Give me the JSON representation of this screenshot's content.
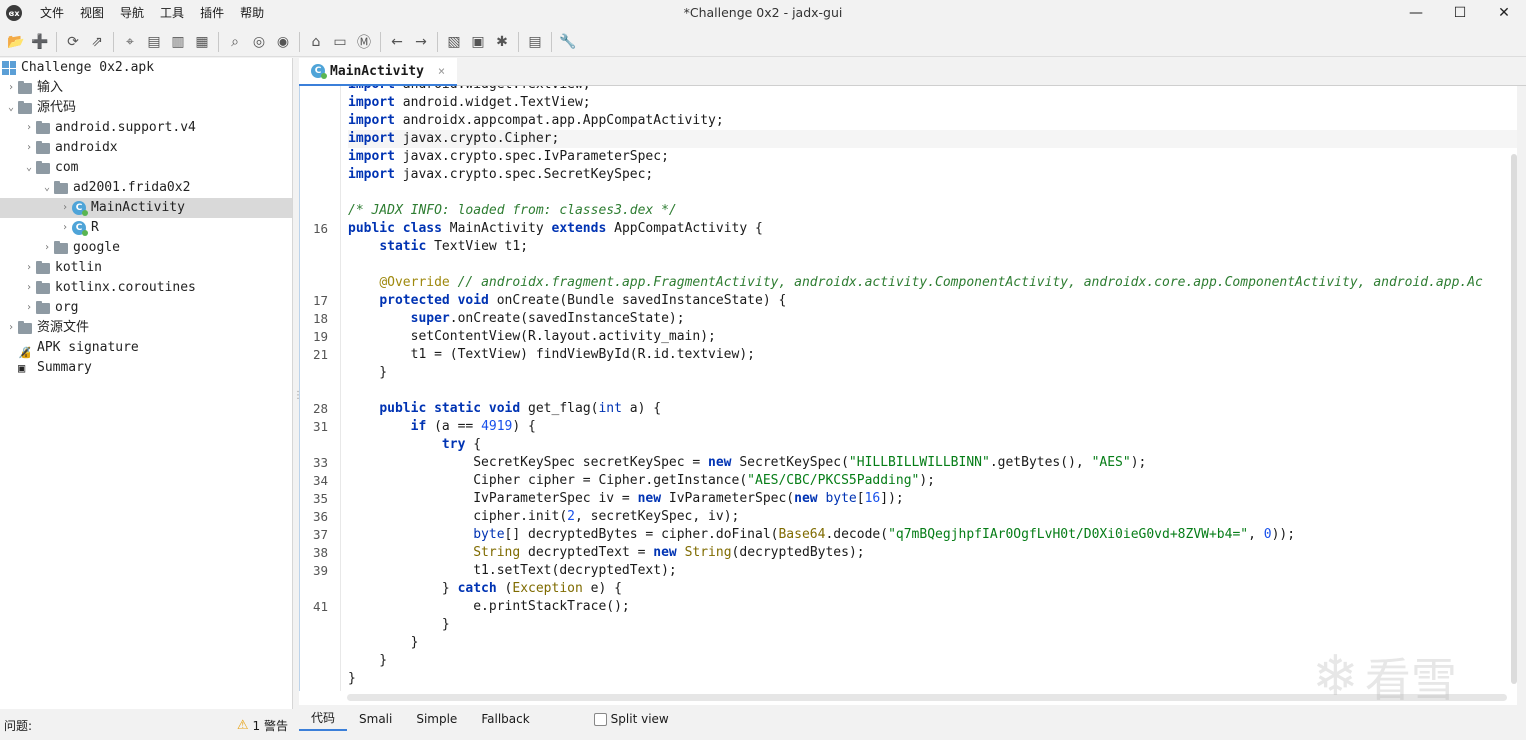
{
  "window": {
    "title": "*Challenge 0x2 - jadx-gui",
    "logo": "ɞx",
    "controls": {
      "minimize": "—",
      "maximize": "☐",
      "close": "✕"
    }
  },
  "menu": [
    "文件",
    "视图",
    "导航",
    "工具",
    "插件",
    "帮助"
  ],
  "toolbar": {
    "icons": [
      "open-file-icon",
      "add-file-icon",
      "sync-icon",
      "export-icon",
      "crosshair-icon",
      "folder-icon",
      "split-view-icon",
      "table-icon",
      "search-icon",
      "search-class-icon",
      "search-usage-icon",
      "home-icon",
      "window-icon",
      "module-icon",
      "back-arrow-icon",
      "forward-arrow-icon",
      "deobfuscation-icon",
      "bookmark-icon",
      "bug-icon",
      "log-icon",
      "settings-wrench-icon"
    ]
  },
  "tree": {
    "items": [
      {
        "label": "Challenge 0x2.apk",
        "icon": "apk",
        "level": 0,
        "arrow": ""
      },
      {
        "label": "输入",
        "icon": "input",
        "level": 0,
        "arrow": "›"
      },
      {
        "label": "源代码",
        "icon": "src",
        "level": 0,
        "arrow": "⌄"
      },
      {
        "label": "android.support.v4",
        "icon": "folder",
        "level": 1,
        "arrow": "›"
      },
      {
        "label": "androidx",
        "icon": "folder",
        "level": 1,
        "arrow": "›"
      },
      {
        "label": "com",
        "icon": "folder",
        "level": 1,
        "arrow": "⌄"
      },
      {
        "label": "ad2001.frida0x2",
        "icon": "folder",
        "level": 2,
        "arrow": "⌄"
      },
      {
        "label": "MainActivity",
        "icon": "class",
        "level": 3,
        "arrow": "›",
        "selected": true
      },
      {
        "label": "R",
        "icon": "class",
        "level": 3,
        "arrow": "›"
      },
      {
        "label": "google",
        "icon": "folder",
        "level": 2,
        "arrow": "›"
      },
      {
        "label": "kotlin",
        "icon": "folder",
        "level": 1,
        "arrow": "›"
      },
      {
        "label": "kotlinx.coroutines",
        "icon": "folder",
        "level": 1,
        "arrow": "›"
      },
      {
        "label": "org",
        "icon": "folder",
        "level": 1,
        "arrow": "›"
      },
      {
        "label": "资源文件",
        "icon": "res",
        "level": 0,
        "arrow": "›"
      },
      {
        "label": "APK signature",
        "icon": "sig",
        "level": 0,
        "arrow": ""
      },
      {
        "label": "Summary",
        "icon": "summary",
        "level": 0,
        "arrow": ""
      }
    ]
  },
  "tab": {
    "label": "MainActivity",
    "close": "×"
  },
  "editor": {
    "lines": [
      {
        "n": "",
        "html": "<span class='kw'>import</span> android.widget.TextView;"
      },
      {
        "n": "",
        "html": "<span class='kw'>import</span> android.widget.TextView;"
      },
      {
        "n": "",
        "html": "<span class='kw'>import</span> androidx.appcompat.app.AppCompatActivity;"
      },
      {
        "n": "",
        "html": "<span class='kw'>import</span> javax.crypto.Cipher;",
        "cur": true
      },
      {
        "n": "",
        "html": "<span class='kw'>import</span> javax.crypto.spec.IvParameterSpec;"
      },
      {
        "n": "",
        "html": "<span class='kw'>import</span> javax.crypto.spec.SecretKeySpec;"
      },
      {
        "n": "",
        "html": ""
      },
      {
        "n": "",
        "html": "<span class='cmt2'>/* JADX INFO: loaded from: classes3.dex */</span>"
      },
      {
        "n": "16",
        "html": "<span class='kw'>public class</span> MainActivity <span class='kw'>extends</span> AppCompatActivity {"
      },
      {
        "n": "",
        "html": "    <span class='kw'>static</span> TextView t1;"
      },
      {
        "n": "",
        "html": ""
      },
      {
        "n": "",
        "html": "    <span class='ann'>@Override</span> <span class='cmt2'>// androidx.fragment.app.FragmentActivity, androidx.activity.ComponentActivity, androidx.core.app.ComponentActivity, android.app.Ac</span>"
      },
      {
        "n": "17",
        "html": "    <span class='kw'>protected void</span> onCreate(Bundle savedInstanceState) {"
      },
      {
        "n": "18",
        "html": "        <span class='kw'>super</span>.onCreate(savedInstanceState);"
      },
      {
        "n": "19",
        "html": "        setContentView(R.layout.activity_main);"
      },
      {
        "n": "21",
        "html": "        t1 = (TextView) findViewById(R.id.textview);"
      },
      {
        "n": "",
        "html": "    }"
      },
      {
        "n": "",
        "html": ""
      },
      {
        "n": "28",
        "html": "    <span class='kw'>public static void</span> get_flag(<span class='kwn'>int</span> a) {"
      },
      {
        "n": "31",
        "html": "        <span class='kw'>if</span> (a == <span class='num'>4919</span>) {"
      },
      {
        "n": "",
        "html": "            <span class='kw'>try</span> {"
      },
      {
        "n": "33",
        "html": "                SecretKeySpec secretKeySpec = <span class='kw'>new</span> SecretKeySpec(<span class='str'>\"HILLBILLWILLBINN\"</span>.getBytes(), <span class='str'>\"AES\"</span>);"
      },
      {
        "n": "34",
        "html": "                Cipher cipher = Cipher.getInstance(<span class='str'>\"AES/CBC/PKCS5Padding\"</span>);"
      },
      {
        "n": "35",
        "html": "                IvParameterSpec iv = <span class='kw'>new</span> IvParameterSpec(<span class='kw'>new</span> <span class='kwn'>byte</span>[<span class='num'>16</span>]);"
      },
      {
        "n": "36",
        "html": "                cipher.init(<span class='num'>2</span>, secretKeySpec, iv);"
      },
      {
        "n": "37",
        "html": "                <span class='kwn'>byte</span>[] decryptedBytes = cipher.doFinal(<span class='typ'>Base64</span>.decode(<span class='str'>\"q7mBQegjhpfIAr0OgfLvH0t/D0Xi0ieG0vd+8ZVW+b4=\"</span>, <span class='num'>0</span>));"
      },
      {
        "n": "38",
        "html": "                <span class='typ'>String</span> decryptedText = <span class='kw'>new</span> <span class='typ'>String</span>(decryptedBytes);"
      },
      {
        "n": "39",
        "html": "                t1.setText(decryptedText);"
      },
      {
        "n": "",
        "html": "            } <span class='kw'>catch</span> (<span class='typ'>Exception</span> e) {"
      },
      {
        "n": "41",
        "html": "                e.printStackTrace();"
      },
      {
        "n": "",
        "html": "            }"
      },
      {
        "n": "",
        "html": "        }"
      },
      {
        "n": "",
        "html": "    }"
      },
      {
        "n": "",
        "html": "}"
      }
    ]
  },
  "bottom_tabs": [
    "代码",
    "Smali",
    "Simple",
    "Fallback"
  ],
  "split_view": "Split view",
  "status": {
    "label": "问题:",
    "warn_icon": "⚠",
    "warn_count": "1 警告"
  },
  "watermark": {
    "glyph": "❄",
    "text": "看雪"
  }
}
